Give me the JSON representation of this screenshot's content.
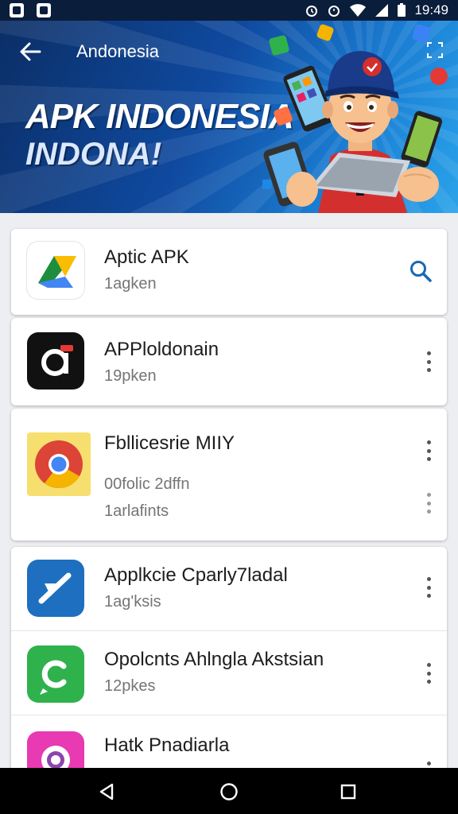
{
  "status_bar": {
    "time": "19:49"
  },
  "header": {
    "title": "Andonesia"
  },
  "banner": {
    "headline": "APK INDONESIA",
    "subheadline": "INDONA!"
  },
  "list": {
    "items": [
      {
        "name": "Aptic APK",
        "meta": "1agken",
        "action": "search-icon"
      },
      {
        "name": "APPloldonain",
        "meta": "19pken",
        "action": "more-vert-icon"
      },
      {
        "name": "Fbllicesrie MIIY",
        "meta": "00folic 2dffn",
        "meta2": "1arlafints",
        "action": "more-vert-icon"
      },
      {
        "name": "Applkcie Cparly7ladal",
        "meta": "1ag'ksis",
        "action": "more-vert-icon"
      },
      {
        "name": "Opolcnts Ahlngla Akstsian",
        "meta": "12pkes",
        "action": "more-vert-icon"
      },
      {
        "name": "Hatk Pnadiarla",
        "meta": "",
        "action": "more-vert-icon"
      }
    ]
  },
  "colors": {
    "banner_dark": "#0b2e66",
    "banner_light": "#2aa3ea",
    "accent": "#1967b3",
    "background": "#eceef1"
  }
}
